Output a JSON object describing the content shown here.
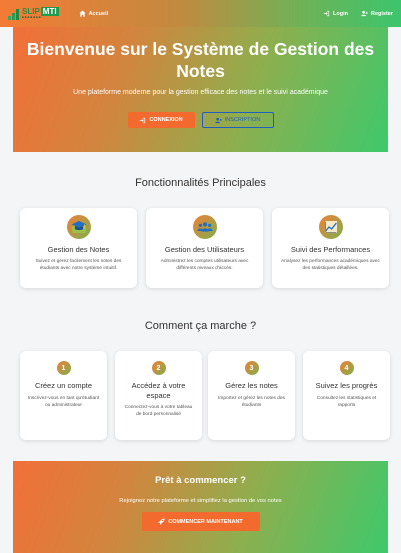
{
  "navbar": {
    "logo_text": "SLIP",
    "logo_badge": "MTI",
    "logo_tagline": "■■■■■■■",
    "home_label": "Accueil",
    "login_label": "Login",
    "register_label": "Register"
  },
  "hero": {
    "title": "Bienvenue sur le Système de Gestion des Notes",
    "subtitle": "Une plateforme moderne pour la gestion efficace des notes et le suivi académique",
    "login_button": "CONNEXION",
    "register_button": "INSCRIPTION"
  },
  "features": {
    "title": "Fonctionnalités Principales",
    "items": [
      {
        "title": "Gestion des Notes",
        "desc": "Suivez et gérez facilement les notes des étudiants avec notre système intuitif.",
        "icon": "graduation-cap-icon"
      },
      {
        "title": "Gestion des Utilisateurs",
        "desc": "Administrez les comptes utilisateurs avec différents niveaux d'accès.",
        "icon": "users-icon"
      },
      {
        "title": "Suivi des Performances",
        "desc": "Analysez les performances académiques avec des statistiques détaillées.",
        "icon": "chart-line-icon"
      }
    ]
  },
  "steps": {
    "title": "Comment ça marche ?",
    "items": [
      {
        "num": "1",
        "title": "Créez un compte",
        "desc": "Inscrivez-vous en tant qu'étudiant ou administrateur"
      },
      {
        "num": "2",
        "title": "Accédez à votre espace",
        "desc": "Connectez-vous à votre tableau de bord personnalisé"
      },
      {
        "num": "3",
        "title": "Gérez les notes",
        "desc": "Importez et gérez les notes des étudiants"
      },
      {
        "num": "4",
        "title": "Suivez les progrès",
        "desc": "Consultez les statistiques et rapports"
      }
    ]
  },
  "cta": {
    "title": "Prêt à commencer ?",
    "subtitle": "Rejoignez notre plateforme et simplifiez la gestion de vos notes",
    "button": "COMMENCER MAINTENANT"
  },
  "colors": {
    "gradient_start": "#f26f39",
    "gradient_end": "#3ec96b",
    "primary_button": "#f26a2e",
    "outline_button": "#1d5fbf"
  }
}
